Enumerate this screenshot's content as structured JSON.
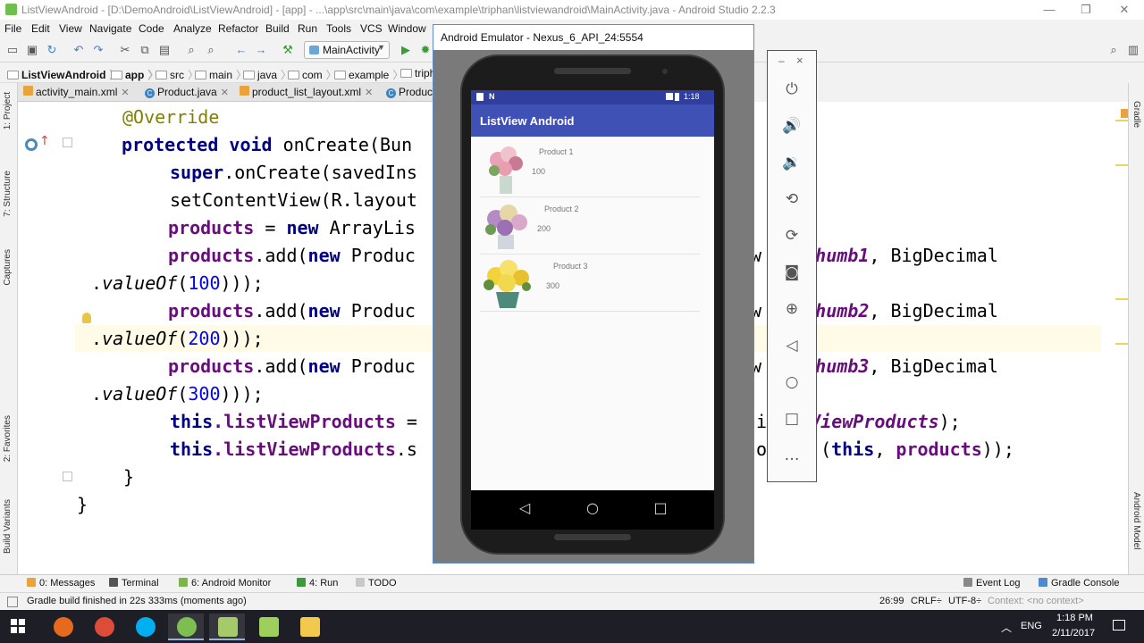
{
  "window": {
    "title": "ListViewAndroid - [D:\\DemoAndroid\\ListViewAndroid] - [app] - ...\\app\\src\\main\\java\\com\\example\\triphan\\listviewandroid\\MainActivity.java - Android Studio 2.2.3",
    "minimize_icon": "minimize-icon",
    "maximize_icon": "maximize-icon",
    "close_icon": "close-icon"
  },
  "menu": [
    "File",
    "Edit",
    "View",
    "Navigate",
    "Code",
    "Analyze",
    "Refactor",
    "Build",
    "Run",
    "Tools",
    "VCS",
    "Window"
  ],
  "toolbar": {
    "run_config": "MainActivity"
  },
  "breadcrumb": [
    "ListViewAndroid",
    "app",
    "src",
    "main",
    "java",
    "com",
    "example",
    "triph"
  ],
  "tabs": [
    {
      "label": "activity_main.xml",
      "icon": "xml-icon"
    },
    {
      "label": "Product.java",
      "icon": "class-icon"
    },
    {
      "label": "product_list_layout.xml",
      "icon": "xml-icon"
    },
    {
      "label": "Produc",
      "icon": "class-icon"
    }
  ],
  "left_strip": [
    "1: Project",
    "7: Structure",
    "Captures",
    "2: Favorites",
    "Build Variants"
  ],
  "right_strip": [
    "Gradle",
    "Android Model"
  ],
  "code": {
    "l1": "@Override",
    "l2_kw": "protected void ",
    "l2_rest": "onCreate(Bun",
    "l3_kw": "super",
    "l3_rest": ".onCreate(savedIns",
    "l4": "setContentView(R.layout",
    "l5_fld": "products",
    "l5_mid": " = ",
    "l5_kw": "new",
    "l5_rest": " ArrayLis",
    "add_fld": "products",
    "add_mid": ".add(",
    "add_kw": "new",
    "add_rest": " Produc",
    "right_pre": "aw",
    "right_dot": ".",
    "thumb1": "thumb1",
    "thumb2": "thumb2",
    "thumb3": "thumb3",
    "right_post": ", BigDecimal",
    "value_of": "valueOf",
    "v100": "100",
    "v200": "200",
    "v300": "300",
    "close_paren": ")));",
    "l12_kw": "this",
    "l12_fld": ".listViewProducts",
    "l12_rest": " =",
    "l12_right_pre": "i",
    "l12_right_fld": "stViewProducts",
    "l12_right_post": ");",
    "l13_rest": ".s",
    "l13_right_pre": "od",
    "l13_right_kw": "this",
    "l13_right_fld": "products",
    "l13_right_mid": "(",
    "l13_right_comma": ", ",
    "l13_right_post": "));",
    "brace1": "}",
    "brace2": "}"
  },
  "emulator": {
    "title": "Android Emulator - Nexus_6_API_24:5554",
    "status_time": "1:18",
    "app_title": "ListView Android",
    "items": [
      {
        "name": "Product 1",
        "price": "100"
      },
      {
        "name": "Product 2",
        "price": "200"
      },
      {
        "name": "Product 3",
        "price": "300"
      }
    ],
    "side_panel": {
      "minimize": "–",
      "close": "×",
      "buttons": [
        "power-icon",
        "volume-up-icon",
        "volume-down-icon",
        "rotate-left-icon",
        "rotate-right-icon",
        "camera-icon",
        "zoom-icon",
        "back-icon",
        "home-icon",
        "overview-icon",
        "more-icon"
      ]
    }
  },
  "bottom_tools": {
    "messages": "0: Messages",
    "terminal": "Terminal",
    "monitor": "6: Android Monitor",
    "run": "4: Run",
    "todo": "TODO",
    "event_log": "Event Log",
    "gradle_console": "Gradle Console"
  },
  "status": {
    "message": "Gradle build finished in 22s 333ms (moments ago)",
    "position": "26:99",
    "line_sep": "CRLF÷",
    "encoding": "UTF-8÷",
    "context": "Context: <no context>"
  },
  "taskbar": {
    "lang": "ENG",
    "time": "1:18 PM",
    "date": "2/11/2017"
  },
  "colors": {
    "keyword": "#000080",
    "field": "#660e7a",
    "number": "#0000ff",
    "annotation": "#808000",
    "appbar": "#3f51b5",
    "statusbar": "#303f9f"
  }
}
